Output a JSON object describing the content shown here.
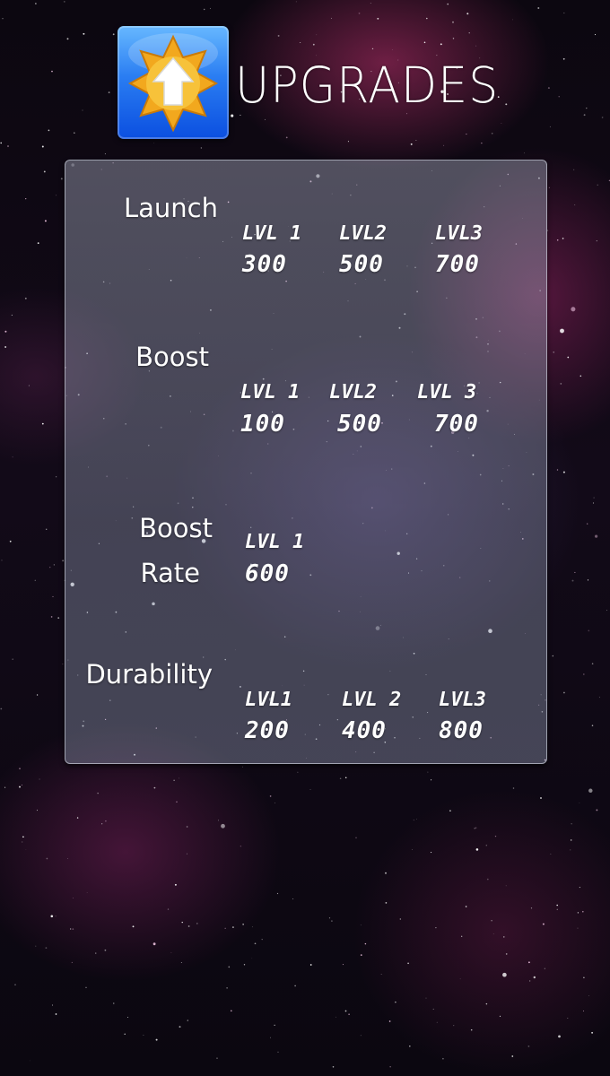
{
  "header": {
    "title": "UPGRADES",
    "icon": "upgrade-arrow-star-icon"
  },
  "upgrades": [
    {
      "name": "Launch",
      "tiers": [
        {
          "level": "LVL 1",
          "cost": "300"
        },
        {
          "level": "LVL2",
          "cost": "500"
        },
        {
          "level": "LVL3",
          "cost": "700"
        }
      ]
    },
    {
      "name": "Boost",
      "tiers": [
        {
          "level": "LVL 1",
          "cost": "100"
        },
        {
          "level": "LVL2",
          "cost": "500"
        },
        {
          "level": "LVL 3",
          "cost": "700"
        }
      ]
    },
    {
      "name_line1": "Boost",
      "name_line2": "Rate",
      "tiers": [
        {
          "level": "LVL 1",
          "cost": "600"
        }
      ]
    },
    {
      "name": "Durability",
      "tiers": [
        {
          "level": "LVL1",
          "cost": "200"
        },
        {
          "level": "LVL 2",
          "cost": "400"
        },
        {
          "level": "LVL3",
          "cost": "800"
        }
      ]
    }
  ],
  "colors": {
    "text": "#ffffff",
    "icon_blue": "#1f6cf0",
    "star_gold": "#f2a81e"
  }
}
